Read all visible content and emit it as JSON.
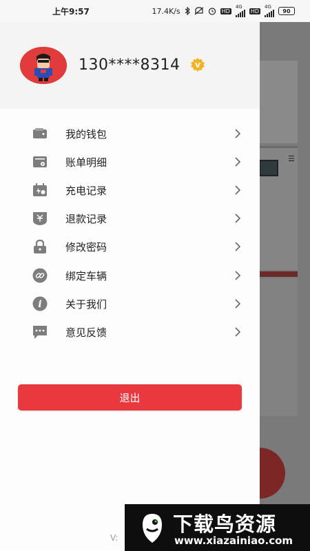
{
  "status_bar": {
    "time": "上午9:57",
    "network_speed": "17.4K/s",
    "network_4g_1": "4G",
    "hd_1": "HD",
    "network_4g_2": "4G",
    "hd_2": "HD",
    "battery": "90"
  },
  "drawer": {
    "user": {
      "phone": "130****8314",
      "badge": "V"
    },
    "menu": [
      {
        "label": "我的钱包",
        "icon": "wallet-icon"
      },
      {
        "label": "账单明细",
        "icon": "bill-icon"
      },
      {
        "label": "充电记录",
        "icon": "charging-record-icon"
      },
      {
        "label": "退款记录",
        "icon": "refund-icon"
      },
      {
        "label": "修改密码",
        "icon": "lock-icon"
      },
      {
        "label": "绑定车辆",
        "icon": "link-icon"
      },
      {
        "label": "关于我们",
        "icon": "info-icon"
      },
      {
        "label": "意见反馈",
        "icon": "feedback-icon"
      }
    ],
    "logout_label": "退出",
    "version": "V:"
  },
  "watermark": {
    "title": "下载鸟资源",
    "url": "www.xiazainiao.com"
  },
  "colors": {
    "accent": "#e8393f",
    "header_bg": "#f4f4f4",
    "badge": "#f0b428"
  }
}
